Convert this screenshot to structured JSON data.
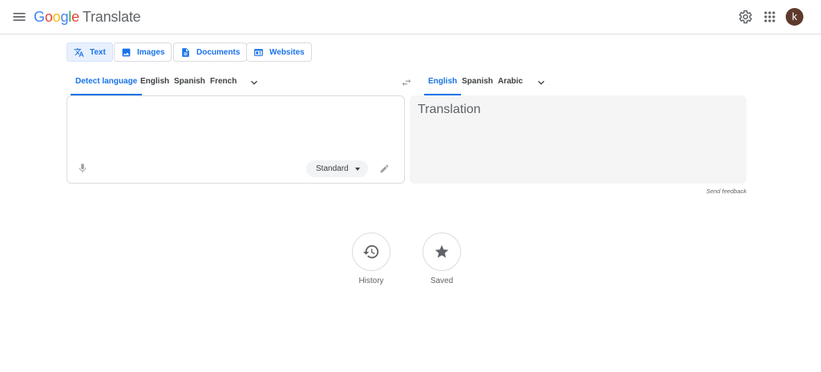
{
  "header": {
    "logo_letters": [
      "G",
      "o",
      "o",
      "g",
      "l",
      "e"
    ],
    "product": "Translate",
    "avatar_initial": "k",
    "colors": {
      "brand_blue": "#4285f4",
      "brand_red": "#ea4335",
      "brand_yellow": "#fbbc05",
      "brand_green": "#34a853"
    }
  },
  "modes": [
    {
      "label": "Text",
      "icon": "translate-icon",
      "active": true
    },
    {
      "label": "Images",
      "icon": "image-icon",
      "active": false
    },
    {
      "label": "Documents",
      "icon": "document-icon",
      "active": false
    },
    {
      "label": "Websites",
      "icon": "website-icon",
      "active": false
    }
  ],
  "source_langs": [
    "Detect language",
    "English",
    "Spanish",
    "French"
  ],
  "target_langs": [
    "English",
    "Spanish",
    "Arabic"
  ],
  "source": {
    "value": "",
    "tone": "Standard"
  },
  "target": {
    "placeholder": "Translation"
  },
  "feedback": "Send feedback",
  "bottom": {
    "history": "History",
    "saved": "Saved"
  },
  "accent": "#1a73e8"
}
